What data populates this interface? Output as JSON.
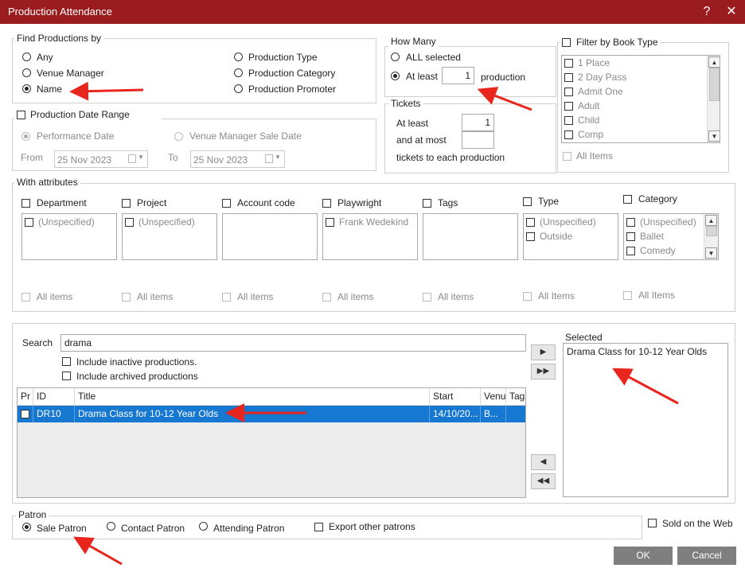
{
  "window": {
    "title": "Production Attendance",
    "help_label": "?",
    "close_label": "✕"
  },
  "find": {
    "legend": "Find Productions by",
    "options": [
      "Any",
      "Venue Manager",
      "Name",
      "Production Type",
      "Production Category",
      "Production Promoter"
    ],
    "selected": "Name"
  },
  "how_many": {
    "legend": "How Many",
    "all_label": "ALL selected",
    "at_least_label": "At least",
    "at_least_value": "1",
    "suffix": "production",
    "selected": "At least"
  },
  "tickets": {
    "legend": "Tickets",
    "at_least_label": "At least",
    "at_least_value": "1",
    "at_most_label": "and at most",
    "at_most_value": "",
    "footer": "tickets to each production"
  },
  "book_type": {
    "label": "Filter by Book Type",
    "items": [
      "1 Place",
      "2 Day Pass",
      "Admit One",
      "Adult",
      "Child",
      "Comp"
    ],
    "all_label": "All Items"
  },
  "date_range": {
    "label": "Production Date Range",
    "perf_label": "Performance Date",
    "vm_sale_label": "Venue Manager Sale Date",
    "from_label": "From",
    "from_value": "25 Nov 2023",
    "to_label": "To",
    "to_value": "25 Nov 2023"
  },
  "attributes": {
    "legend": "With attributes",
    "groups": [
      {
        "label": "Department",
        "items": [
          "(Unspecified)"
        ],
        "all": "All items"
      },
      {
        "label": "Project",
        "items": [
          "(Unspecified)"
        ],
        "all": "All items"
      },
      {
        "label": "Account code",
        "items": [],
        "all": "All items"
      },
      {
        "label": "Playwright",
        "items": [
          "Frank Wedekind"
        ],
        "all": "All items"
      },
      {
        "label": "Tags",
        "items": [],
        "all": "All items"
      },
      {
        "label": "Type",
        "items": [
          "(Unspecified)",
          "Outside"
        ],
        "all": "All Items"
      },
      {
        "label": "Category",
        "items": [
          "(Unspecified)",
          "Ballet",
          "Comedy"
        ],
        "all": "All Items"
      }
    ]
  },
  "search": {
    "label": "Search",
    "value": "drama",
    "inactive_label": "Include inactive productions.",
    "archived_label": "Include archived productions"
  },
  "grid": {
    "columns": [
      "Pr",
      "ID",
      "Title",
      "Start",
      "Venu",
      "Tags"
    ],
    "rows": [
      {
        "id": "DR10",
        "title": "Drama Class for 10-12 Year Olds",
        "start": "14/10/20...",
        "venue": "B..."
      }
    ]
  },
  "move": {
    "add": "▶",
    "add_all": "▶▶",
    "remove": "◀",
    "remove_all": "◀◀"
  },
  "selected": {
    "label": "Selected",
    "items": [
      "Drama Class for 10-12 Year Olds"
    ]
  },
  "patron": {
    "legend": "Patron",
    "options": [
      "Sale Patron",
      "Contact Patron",
      "Attending Patron"
    ],
    "selected": "Sale Patron",
    "export_label": "Export other patrons",
    "web_label": "Sold on the Web"
  },
  "buttons": {
    "ok": "OK",
    "cancel": "Cancel"
  },
  "colors": {
    "titlebar": "#9b1c1f",
    "selection": "#1778d2",
    "annotation": "#e8261e"
  }
}
